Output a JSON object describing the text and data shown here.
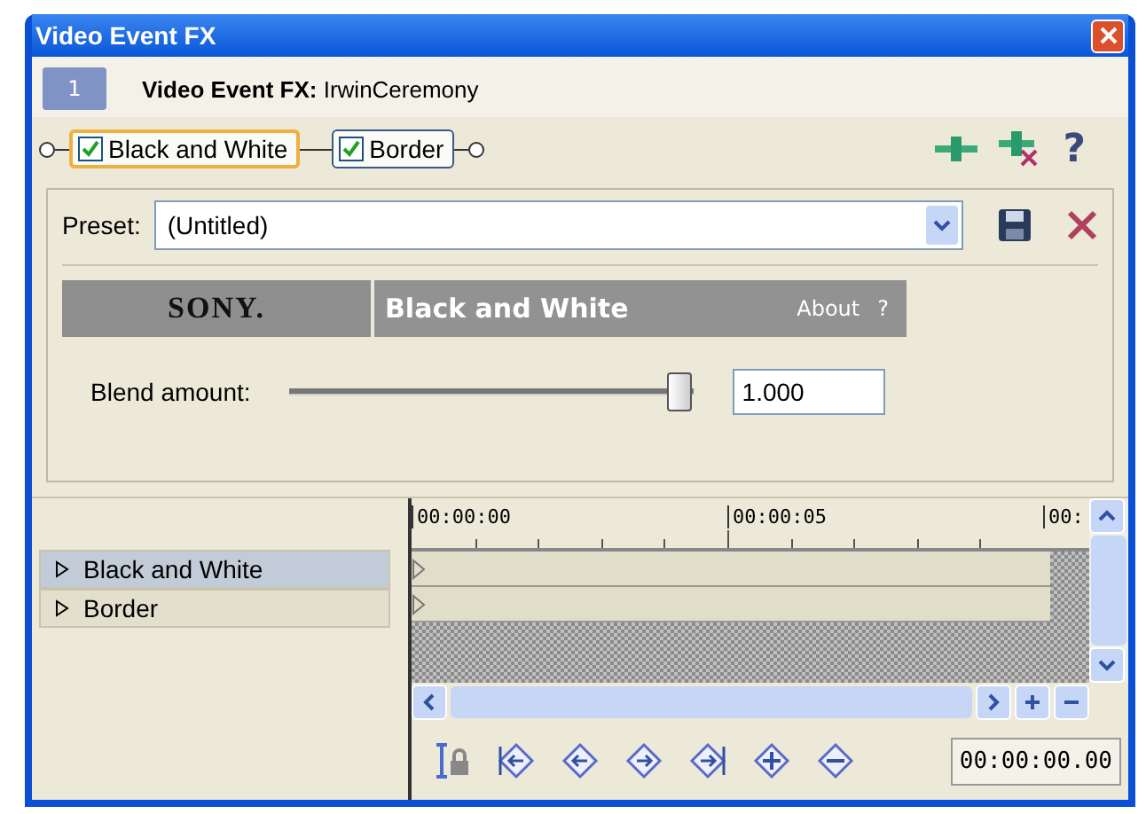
{
  "window": {
    "title": "Video Event FX"
  },
  "header": {
    "track_number": "1",
    "title": "**Video Event FX:** IrwinCeremony"
  },
  "chain": [
    {
      "label": "Black and White",
      "checked": true,
      "selected": true
    },
    {
      "label": "Border",
      "checked": true,
      "selected": false
    }
  ],
  "chain_tools": {
    "help": "?"
  },
  "preset": {
    "label": "Preset:",
    "value": "(Untitled)"
  },
  "plugin": {
    "brand": "SONY.",
    "name": "Black and White",
    "about": "About",
    "help": "?"
  },
  "blend": {
    "label": "Blend amount:",
    "level": 1,
    "value": "1.000"
  },
  "keyframes": [
    {
      "label": "Black and White",
      "selected": true
    },
    {
      "label": "Border",
      "selected": false
    }
  ],
  "timeline": {
    "ruler": [
      "00:00:00",
      "00:00:05",
      "00:"
    ]
  },
  "time_display": "00:00:00.00"
}
